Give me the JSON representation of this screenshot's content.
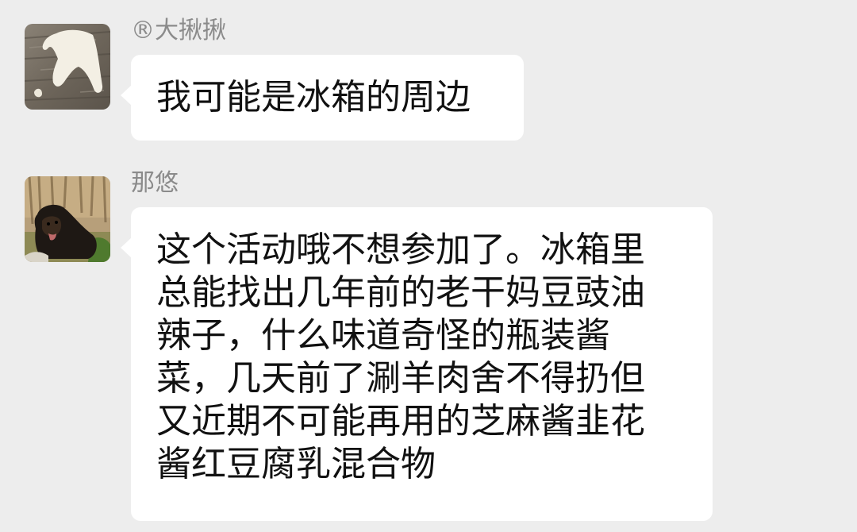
{
  "chat": {
    "messages": [
      {
        "sender": "®大揪揪",
        "avatar_icon": "hand-silhouette-avatar",
        "text": "我可能是冰箱的周边"
      },
      {
        "sender": "那悠",
        "avatar_icon": "dog-photo-avatar",
        "text": "这个活动哦不想参加了。冰箱里\n总能找出几年前的老干妈豆豉油\n辣子，什么味道奇怪的瓶装酱\n菜，几天前了涮羊肉舍不得扔但\n又近期不可能再用的芝麻酱韭花\n酱红豆腐乳混合物"
      }
    ]
  },
  "colors": {
    "background": "#ededed",
    "bubble": "#ffffff",
    "sender_name": "#8b8b8b",
    "message_text": "#111111"
  }
}
